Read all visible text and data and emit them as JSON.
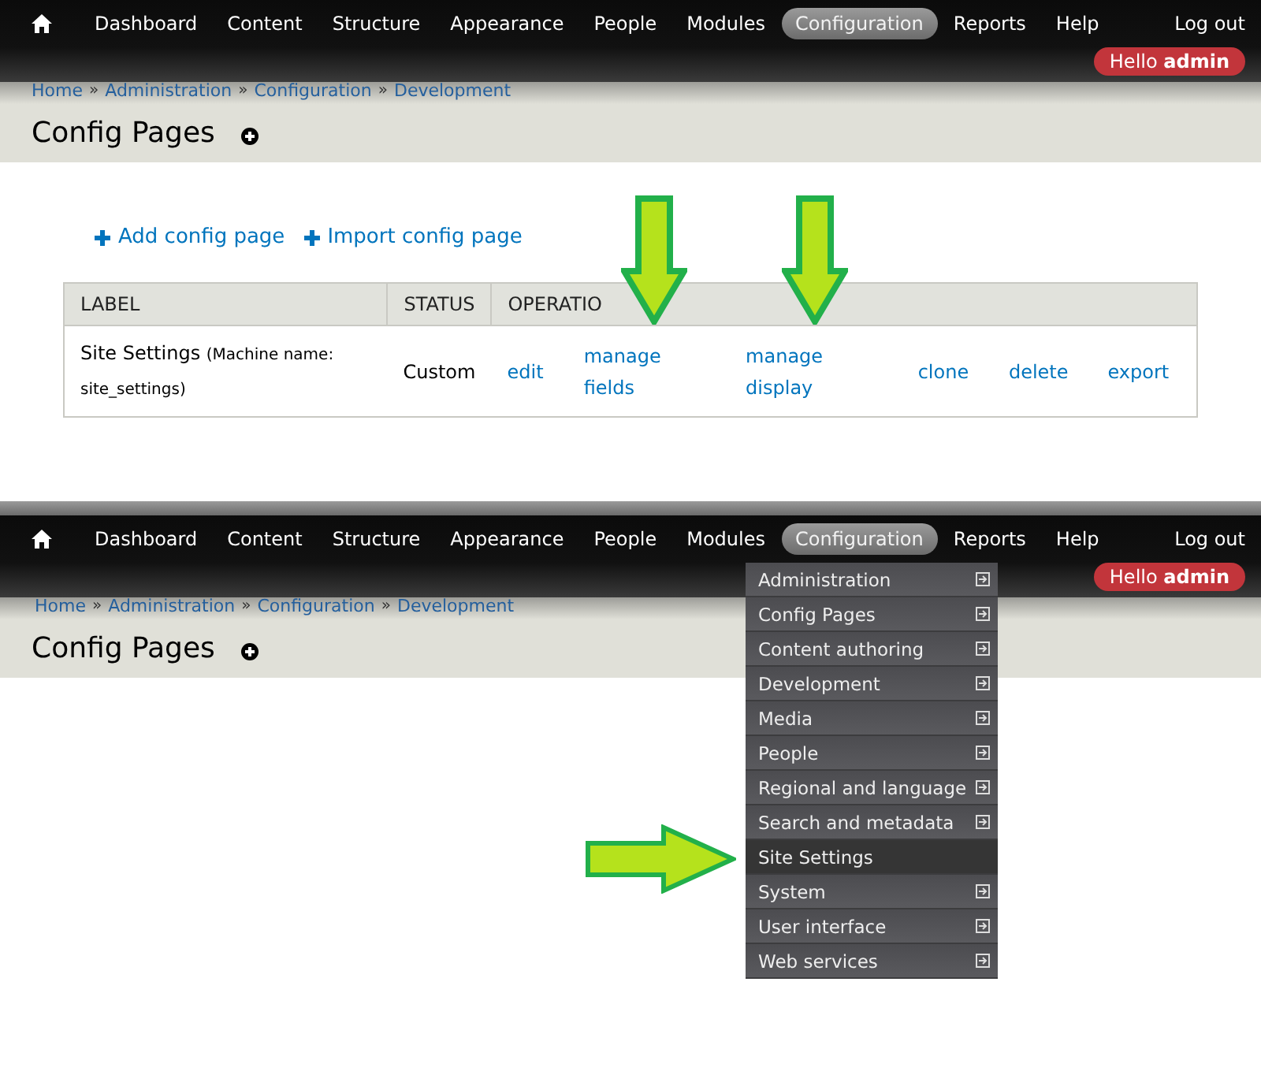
{
  "panels": [
    {
      "toolbar": {
        "items": [
          {
            "label": "Dashboard",
            "selected": false
          },
          {
            "label": "Content",
            "selected": false
          },
          {
            "label": "Structure",
            "selected": false
          },
          {
            "label": "Appearance",
            "selected": false
          },
          {
            "label": "People",
            "selected": false
          },
          {
            "label": "Modules",
            "selected": false
          },
          {
            "label": "Configuration",
            "selected": true
          },
          {
            "label": "Reports",
            "selected": false
          },
          {
            "label": "Help",
            "selected": false
          }
        ],
        "logout": "Log out",
        "greeting": "Hello **admin**"
      },
      "breadcrumb": [
        "Home",
        "Administration",
        "Configuration",
        "Development"
      ],
      "separator": "»",
      "title": "Config Pages",
      "actions": [
        "Add config page",
        "Import config page"
      ],
      "table": {
        "columns": [
          "LABEL",
          "STATUS",
          "OPERATIO"
        ],
        "rows": [
          {
            "label": "Site Settings",
            "machine_name": "(Machine name: site_settings)",
            "status": "Custom",
            "operations": [
              "edit",
              "manage fields",
              "manage display",
              "clone",
              "delete",
              "export"
            ]
          }
        ]
      }
    },
    {
      "toolbar": {
        "items": [
          {
            "label": "Dashboard",
            "selected": false
          },
          {
            "label": "Content",
            "selected": false
          },
          {
            "label": "Structure",
            "selected": false
          },
          {
            "label": "Appearance",
            "selected": false
          },
          {
            "label": "People",
            "selected": false
          },
          {
            "label": "Modules",
            "selected": false
          },
          {
            "label": "Configuration",
            "selected": true
          },
          {
            "label": "Reports",
            "selected": false
          },
          {
            "label": "Help",
            "selected": false
          }
        ],
        "logout": "Log out",
        "greeting": "Hello **admin**"
      },
      "breadcrumb": [
        "Home",
        "Administration",
        "Configuration",
        "Development"
      ],
      "separator": "»",
      "title": "Config Pages",
      "dropdown": [
        {
          "label": "Administration",
          "submenu": true,
          "selected": false
        },
        {
          "label": "Config Pages",
          "submenu": true,
          "selected": false
        },
        {
          "label": "Content authoring",
          "submenu": true,
          "selected": false
        },
        {
          "label": "Development",
          "submenu": true,
          "selected": false
        },
        {
          "label": "Media",
          "submenu": true,
          "selected": false
        },
        {
          "label": "People",
          "submenu": true,
          "selected": false
        },
        {
          "label": "Regional and language",
          "submenu": true,
          "selected": false
        },
        {
          "label": "Search and metadata",
          "submenu": true,
          "selected": false
        },
        {
          "label": "Site Settings",
          "submenu": false,
          "selected": true
        },
        {
          "label": "System",
          "submenu": true,
          "selected": false
        },
        {
          "label": "User interface",
          "submenu": true,
          "selected": false
        },
        {
          "label": "Web services",
          "submenu": true,
          "selected": false
        }
      ]
    }
  ]
}
